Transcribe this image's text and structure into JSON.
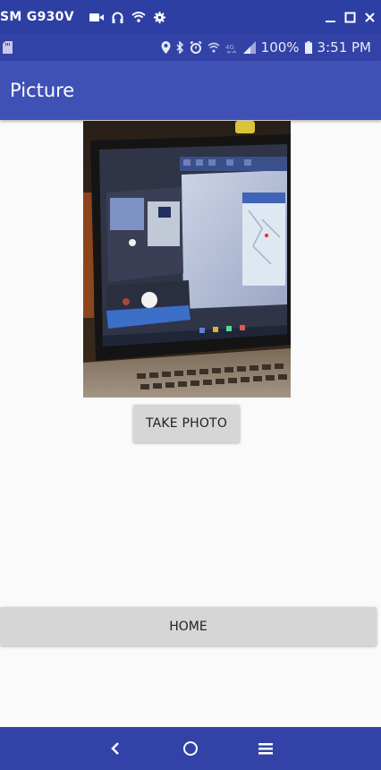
{
  "caption": {
    "device_name": "SM G930V",
    "icons": [
      "video-camera-icon",
      "headphones-icon",
      "wifi-icon",
      "settings-icon"
    ],
    "window_controls": [
      "minimize-icon",
      "maximize-icon",
      "close-icon"
    ]
  },
  "status_bar": {
    "left_icons": [
      "sd-card-icon"
    ],
    "right_icons": [
      "location-icon",
      "bluetooth-icon",
      "alarm-icon",
      "wifi-calling-icon",
      "lte-icon",
      "signal-icon"
    ],
    "battery_text": "100%",
    "time": "3:51 PM"
  },
  "app_bar": {
    "title": "Picture"
  },
  "photo": {
    "description_icon": "captured-photo"
  },
  "buttons": {
    "take_photo": "TAKE PHOTO",
    "home": "HOME"
  },
  "nav_bar": {
    "icons": [
      "back-icon",
      "home-circle-icon",
      "menu-icon"
    ]
  },
  "colors": {
    "primary": "#3f51b5",
    "status": "#3342a6",
    "button_bg": "#d6d6d6",
    "background": "#fafafa"
  }
}
